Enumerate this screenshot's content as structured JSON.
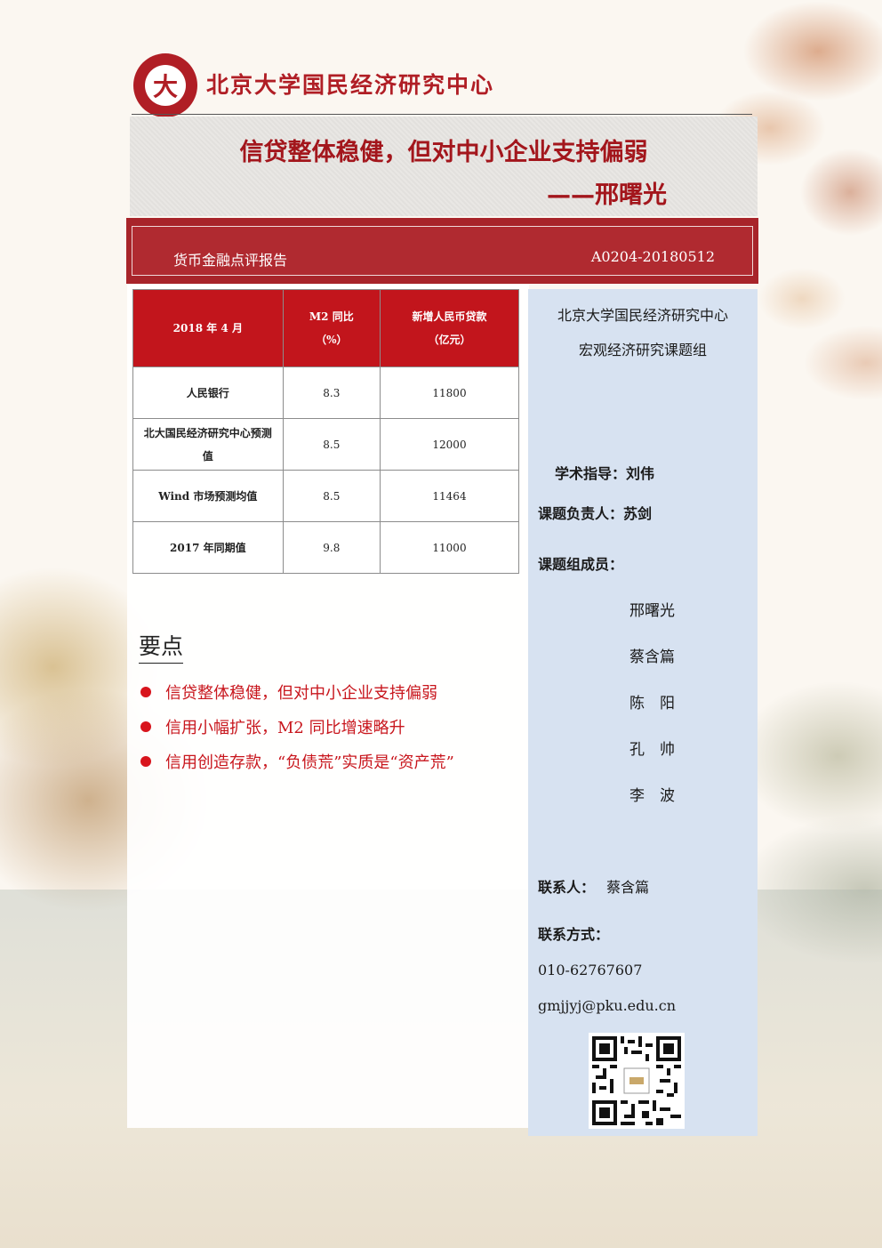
{
  "header": {
    "seal_letter": "大",
    "org_name": "北京大学国民经济研究中心"
  },
  "title": {
    "main": "信贷整体稳健，但对中小企业支持偏弱",
    "author": "——邢曙光"
  },
  "report": {
    "type": "货币金融点评报告",
    "code": "A0204-20180512"
  },
  "table": {
    "headers": [
      "2018 年 4 月",
      "M2 同比\n（%）",
      "新增人民币贷款\n（亿元）"
    ],
    "rows": [
      {
        "label": "人民银行",
        "m2": "8.3",
        "loans": "11800"
      },
      {
        "label": "北大国民经济研究中心预测值",
        "m2": "8.5",
        "loans": "12000"
      },
      {
        "label": "Wind 市场预测均值",
        "m2": "8.5",
        "loans": "11464"
      },
      {
        "label": "2017 年同期值",
        "m2": "9.8",
        "loans": "11000"
      }
    ]
  },
  "key_points": {
    "heading": "要点",
    "items": [
      "信贷整体稳健，但对中小企业支持偏弱",
      "信用小幅扩张，M2 同比增速略升",
      "信用创造存款，“负债荒”实质是“资产荒”"
    ]
  },
  "sidebar": {
    "org_line1": "北京大学国民经济研究中心",
    "org_line2": "宏观经济研究课题组",
    "advisor": "学术指导：刘伟",
    "leader": "课题负责人：苏剑",
    "members_label": "课题组成员：",
    "members": [
      "邢曙光",
      "蔡含篇",
      "陈　阳",
      "孔　帅",
      "李　波"
    ],
    "contact_person_label": "联系人：",
    "contact_person": "蔡含篇",
    "contact_method_label": "联系方式：",
    "phone": "010-62767607",
    "email": "gmjjyj@pku.edu.cn"
  },
  "colors": {
    "brand_red": "#b01e25",
    "table_header_red": "#c2151c",
    "sidebar_blue": "#d7e2f1"
  }
}
